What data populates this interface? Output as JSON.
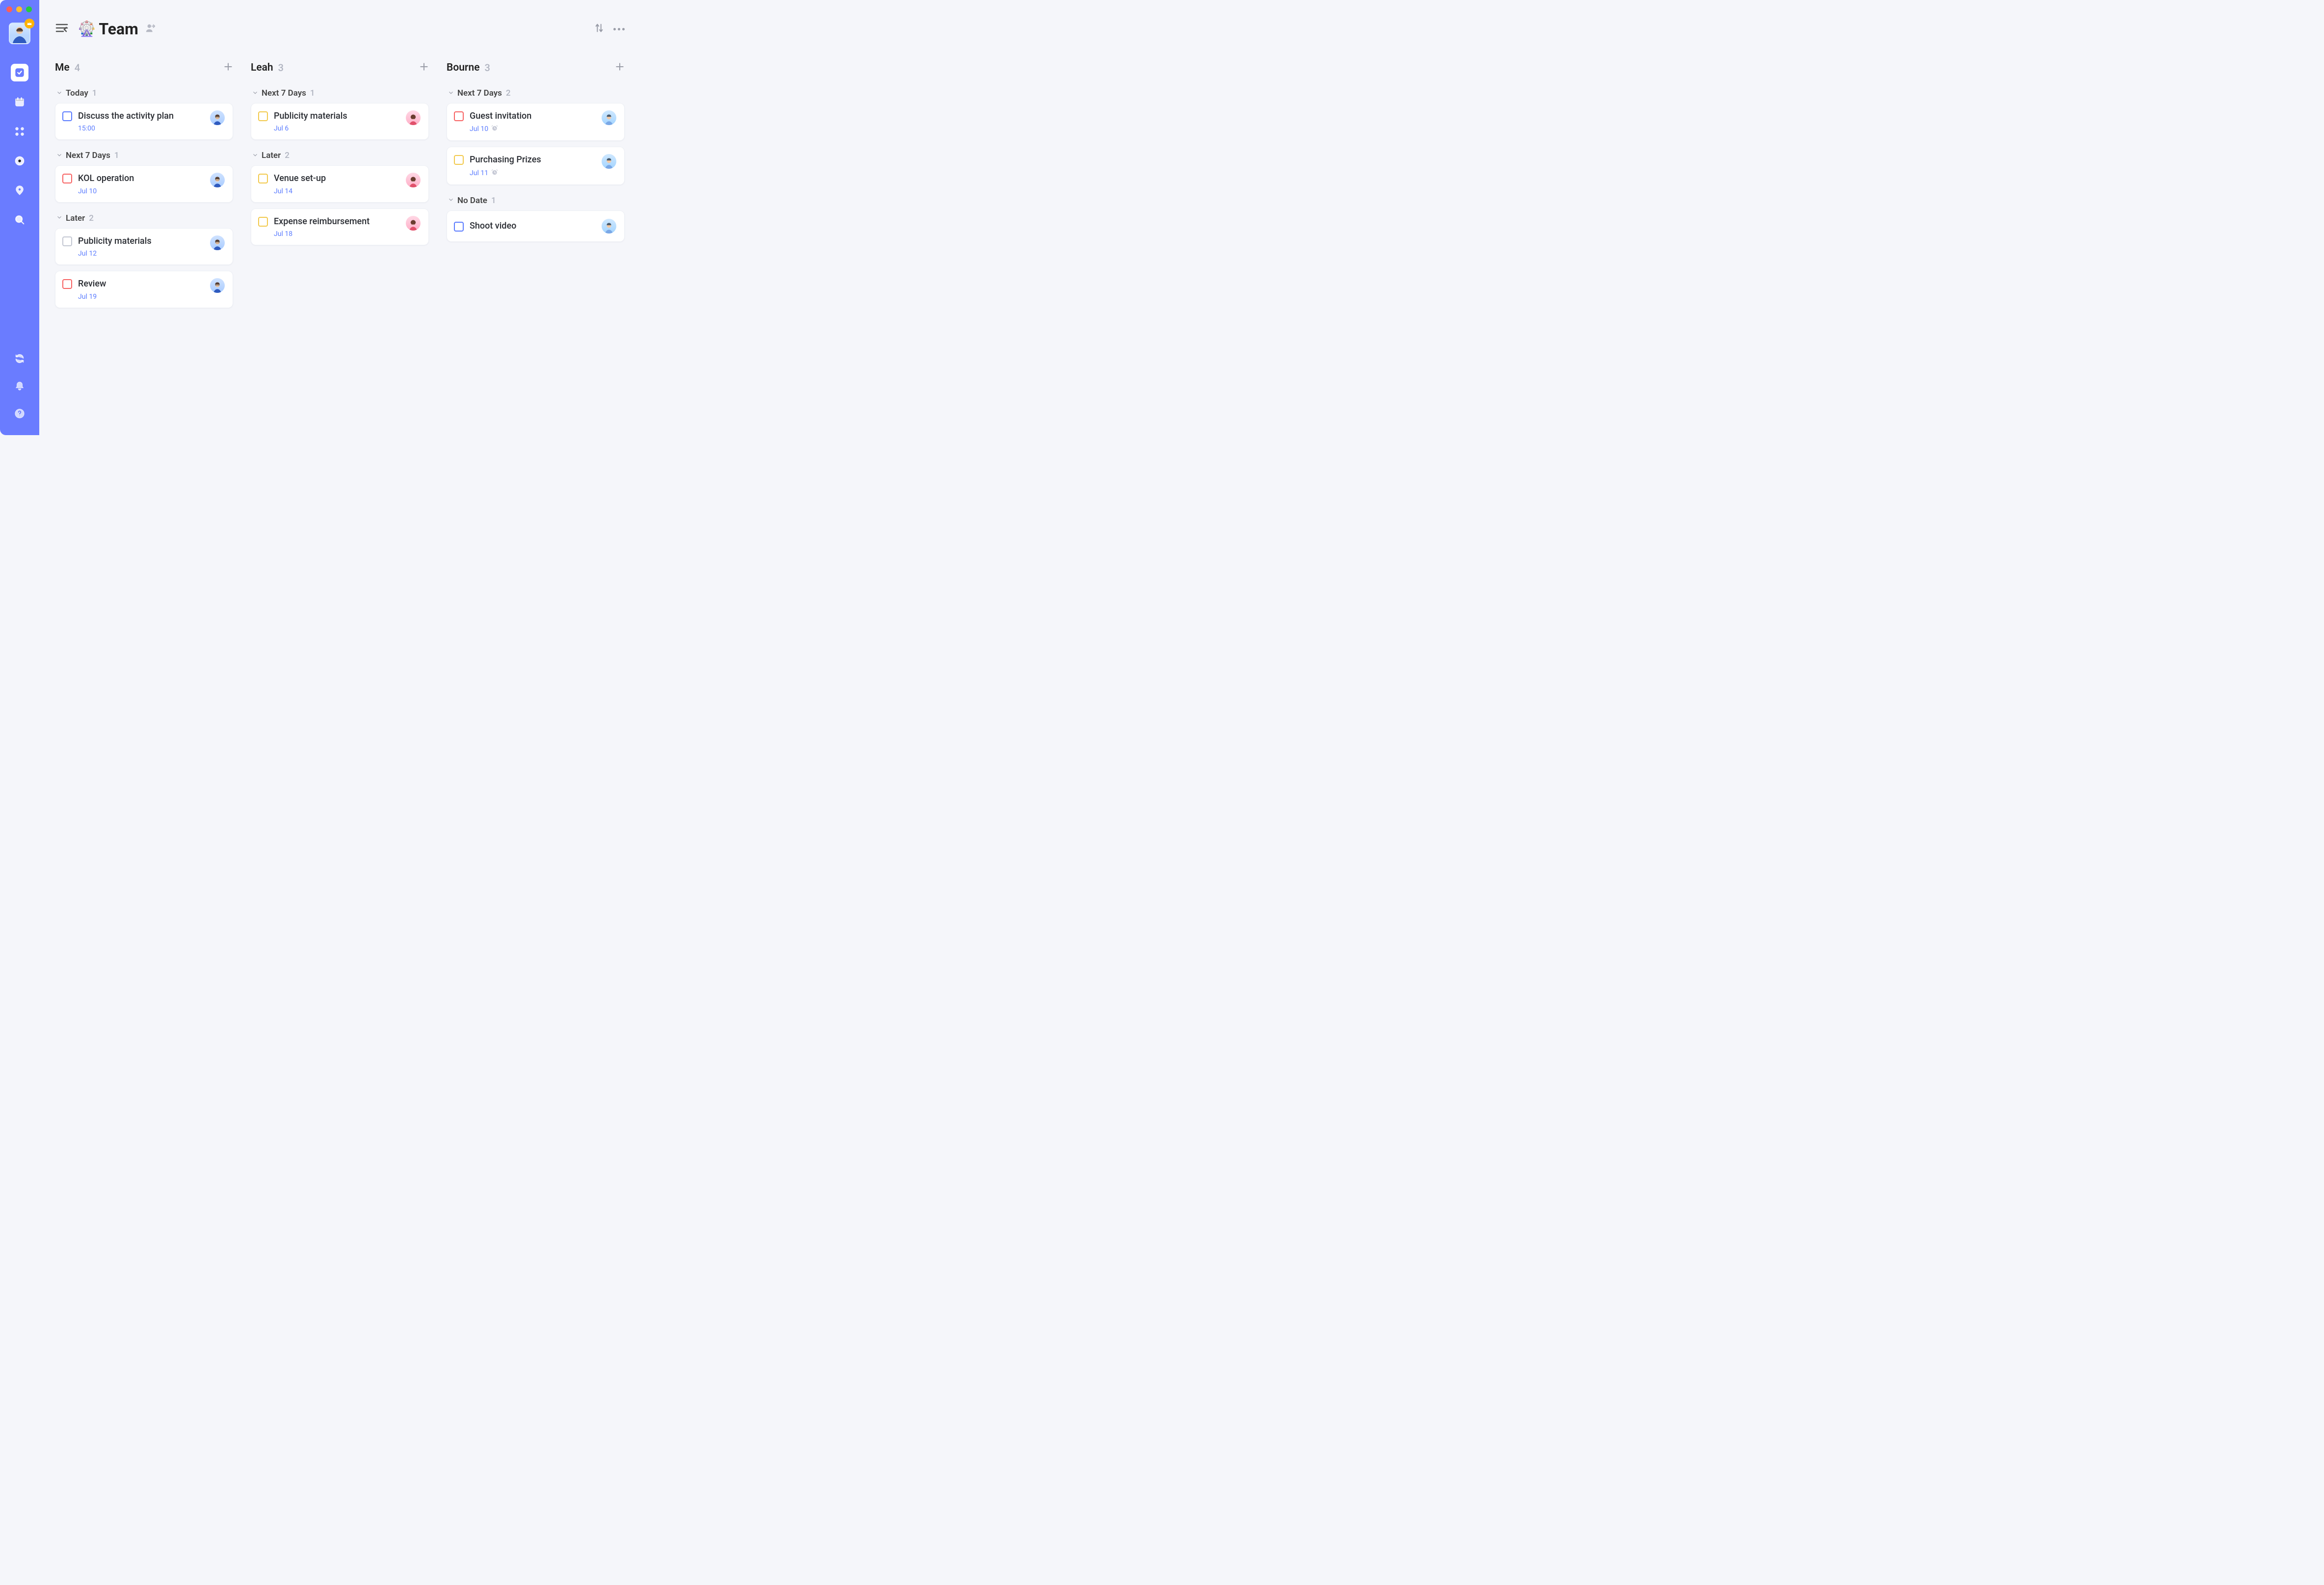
{
  "page": {
    "title": "Team",
    "emoji": "🎡"
  },
  "columns": [
    {
      "name": "Me",
      "count": "4",
      "assignee": "p1",
      "groups": [
        {
          "name": "Today",
          "count": "1",
          "tasks": [
            {
              "title": "Discuss the activity plan",
              "meta": "15:00",
              "priority": "blue",
              "assignee": "p1"
            }
          ]
        },
        {
          "name": "Next 7 Days",
          "count": "1",
          "tasks": [
            {
              "title": "KOL operation",
              "meta": "Jul 10",
              "priority": "red",
              "assignee": "p1"
            }
          ]
        },
        {
          "name": "Later",
          "count": "2",
          "tasks": [
            {
              "title": "Publicity materials",
              "meta": "Jul 12",
              "priority": "grey",
              "assignee": "p1"
            },
            {
              "title": "Review",
              "meta": "Jul 19",
              "priority": "red",
              "assignee": "p1"
            }
          ]
        }
      ]
    },
    {
      "name": "Leah",
      "count": "3",
      "assignee": "p2",
      "groups": [
        {
          "name": "Next 7 Days",
          "count": "1",
          "tasks": [
            {
              "title": "Publicity materials",
              "meta": "Jul 6",
              "priority": "yellow",
              "assignee": "p2"
            }
          ]
        },
        {
          "name": "Later",
          "count": "2",
          "tasks": [
            {
              "title": "Venue set-up",
              "meta": "Jul 14",
              "priority": "yellow",
              "assignee": "p2"
            },
            {
              "title": "Expense reimbursement",
              "meta": "Jul 18",
              "priority": "yellow",
              "assignee": "p2"
            }
          ]
        }
      ]
    },
    {
      "name": "Bourne",
      "count": "3",
      "assignee": "p3",
      "groups": [
        {
          "name": "Next 7 Days",
          "count": "2",
          "tasks": [
            {
              "title": "Guest invitation",
              "meta": "Jul 10",
              "priority": "red",
              "assignee": "p3",
              "alarm": true
            },
            {
              "title": "Purchasing Prizes",
              "meta": "Jul 11",
              "priority": "yellow",
              "assignee": "p3",
              "alarm": true
            }
          ]
        },
        {
          "name": "No Date",
          "count": "1",
          "tasks": [
            {
              "title": "Shoot video",
              "meta": "",
              "priority": "blue",
              "assignee": "p3"
            }
          ]
        }
      ]
    }
  ]
}
